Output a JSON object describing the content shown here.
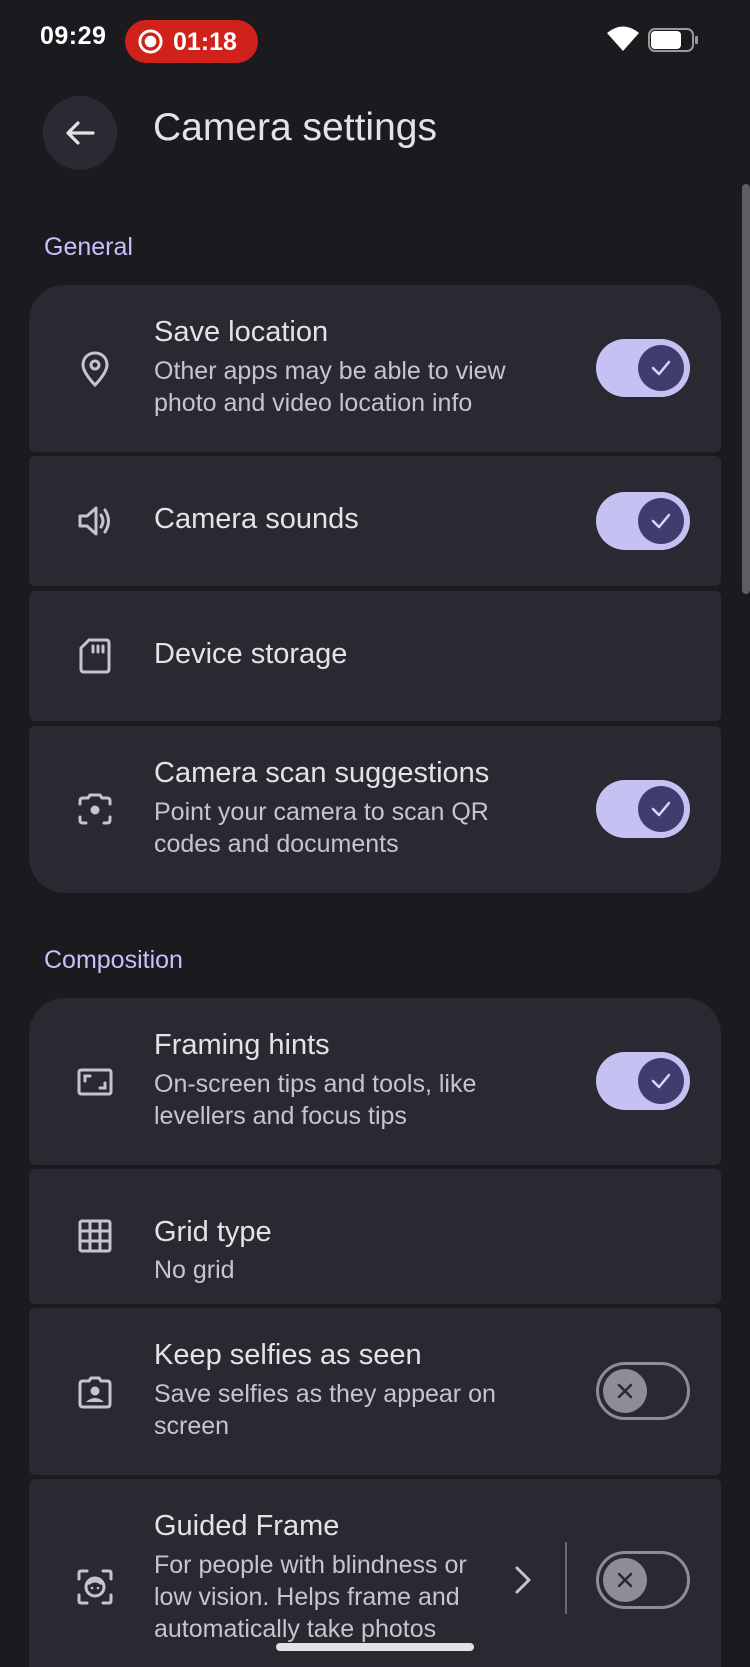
{
  "status_bar": {
    "time": "09:29",
    "recording_time": "01:18",
    "recording_color": "#d0211b",
    "icons": [
      "record-icon",
      "wifi-icon",
      "battery-icon"
    ]
  },
  "header": {
    "back_icon": "arrow-back-icon",
    "title": "Camera settings"
  },
  "sections": [
    {
      "title": "General",
      "items": [
        {
          "icon": "location-pin-icon",
          "title": "Save location",
          "subtitle": "Other apps may be able to view photo and video location info",
          "control": "toggle",
          "checked": true
        },
        {
          "icon": "speaker-icon",
          "title": "Camera sounds",
          "subtitle": "",
          "control": "toggle",
          "checked": true
        },
        {
          "icon": "sd-card-icon",
          "title": "Device storage",
          "subtitle": "",
          "control": "none"
        },
        {
          "icon": "camera-scan-icon",
          "title": "Camera scan suggestions",
          "subtitle": "Point your camera to scan QR codes and documents",
          "control": "toggle",
          "checked": true
        }
      ]
    },
    {
      "title": "Composition",
      "items": [
        {
          "icon": "framing-icon",
          "title": "Framing hints",
          "subtitle": "On-screen tips and tools, like levellers and focus tips",
          "control": "toggle",
          "checked": true
        },
        {
          "icon": "grid-icon",
          "title": "Grid type",
          "subtitle": "No grid",
          "control": "none"
        },
        {
          "icon": "selfie-portrait-icon",
          "title": "Keep selfies as seen",
          "subtitle": "Save selfies as they appear on screen",
          "control": "toggle",
          "checked": false
        },
        {
          "icon": "face-frame-icon",
          "title": "Guided Frame",
          "subtitle": "For people with blindness or low vision. Helps frame and automatically take photos",
          "control": "toggle-with-chevron",
          "checked": false
        }
      ]
    }
  ],
  "colors": {
    "background": "#1b1b1f",
    "card": "#2a2932",
    "accent": "#c7c0ff",
    "toggle_on_track": "#c5c1f2",
    "toggle_on_knob": "#3e3d6e"
  }
}
